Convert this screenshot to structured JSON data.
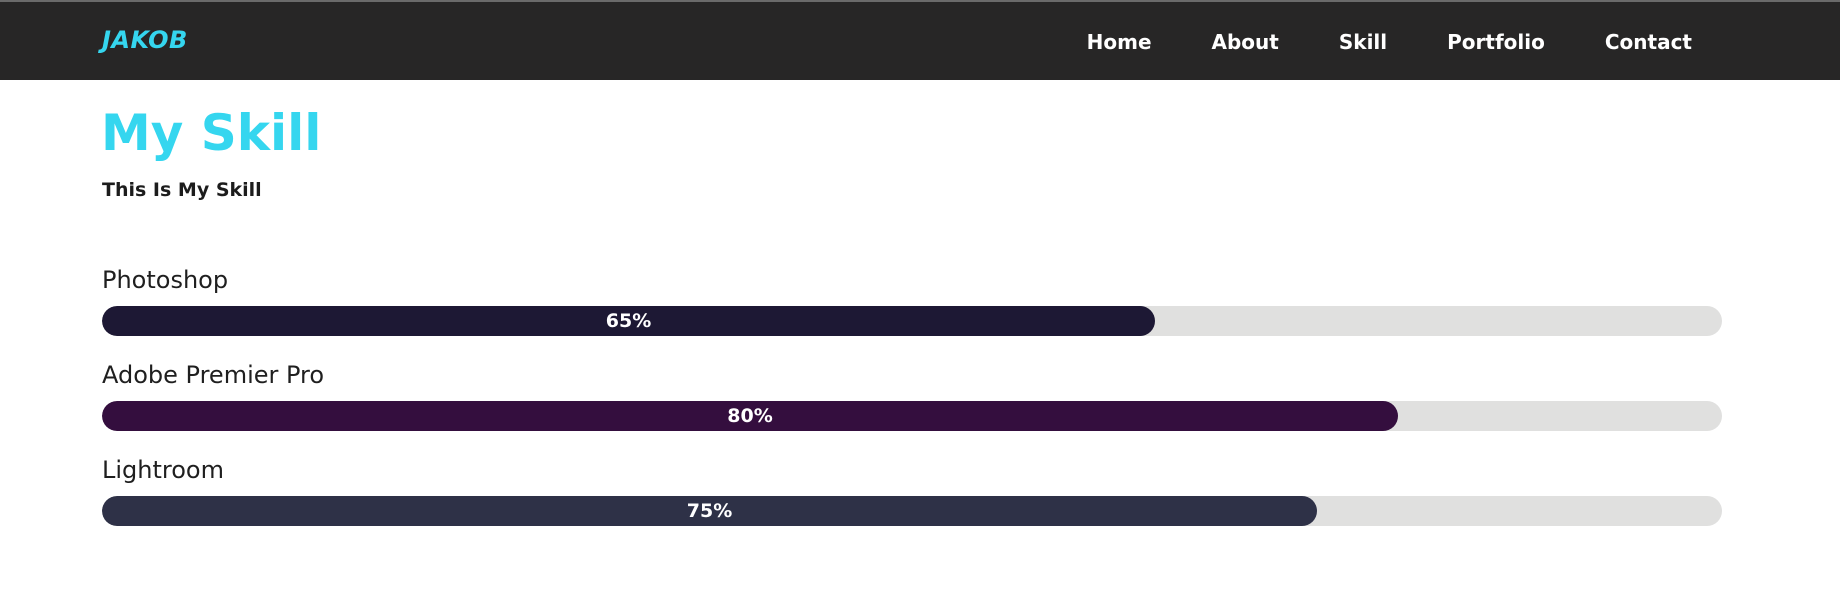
{
  "header": {
    "logo": "JAKOB",
    "nav": [
      {
        "label": "Home"
      },
      {
        "label": "About"
      },
      {
        "label": "Skill"
      },
      {
        "label": "Portfolio"
      },
      {
        "label": "Contact"
      }
    ]
  },
  "section": {
    "title": "My Skill",
    "subtitle": "This Is My Skill"
  },
  "skills": [
    {
      "name": "Photoshop",
      "percent_label": "65%",
      "level": 0.65,
      "color": "#1d1834"
    },
    {
      "name": "Adobe Premier Pro",
      "percent_label": "80%",
      "level": 0.8,
      "color": "#340e3e"
    },
    {
      "name": "Lightroom",
      "percent_label": "75%",
      "level": 0.75,
      "color": "#2e3147"
    }
  ],
  "colors": {
    "accent": "#35d6ef",
    "navbar_bg": "#272626",
    "track": "#e0e0df"
  }
}
